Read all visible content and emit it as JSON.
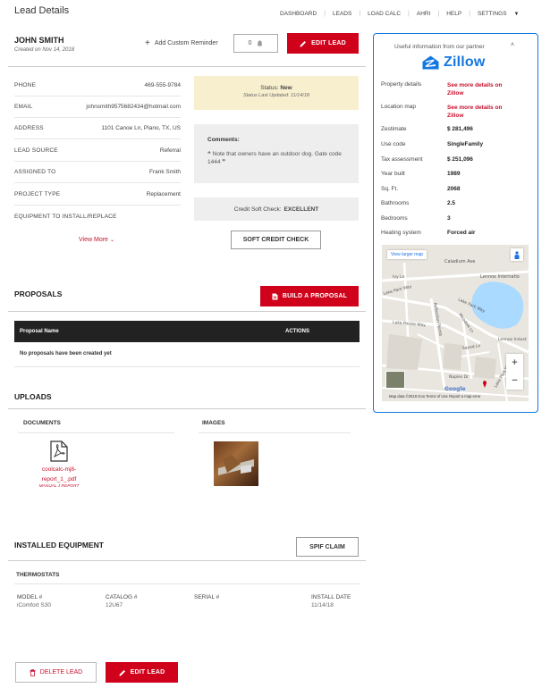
{
  "page": {
    "title": "Lead Details"
  },
  "nav": [
    "DASHBOARD",
    "LEADS",
    "LOAD CALC",
    "AHRI",
    "HELP",
    "SETTINGS"
  ],
  "lead": {
    "name": "JOHN SMITH",
    "created": "Created on Nov 14, 2018",
    "add_reminder": "Add Custom Reminder",
    "reminder_count": "0",
    "edit_label": "EDIT LEAD",
    "fields": [
      {
        "key": "PHONE",
        "value": "469-555-9784"
      },
      {
        "key": "EMAIL",
        "value": "johnsmith9575682434@hotmail.com"
      },
      {
        "key": "ADDRESS",
        "value": "1101 Canoe Ln, Plano, TX, US"
      },
      {
        "key": "LEAD SOURCE",
        "value": "Referral"
      },
      {
        "key": "ASSIGNED TO",
        "value": "Frank Smith"
      },
      {
        "key": "PROJECT TYPE",
        "value": "Replacement"
      },
      {
        "key": "EQUIPMENT TO INSTALL/REPLACE",
        "value": ""
      }
    ],
    "view_more": "View More",
    "status_label": "Status:",
    "status_value": "New",
    "status_updated": "Status Last Updated: 11/14/18",
    "comments_title": "Comments:",
    "comments_text": "Note that owners have an outdoor dog. Gate code 1444",
    "credit_label": "Credit Soft Check:",
    "credit_value": "EXCELLENT",
    "soft_credit_button": "SOFT CREDIT CHECK"
  },
  "zillow": {
    "partner_text": "Useful information from our partner",
    "brand": "Zillow",
    "rows": [
      {
        "key": "Property details",
        "value": "See more details on Zillow",
        "link": true
      },
      {
        "key": "Location map",
        "value": "See more details on Zillow",
        "link": true
      },
      {
        "key": "Zestimate",
        "value": "$ 281,496"
      },
      {
        "key": "Use code",
        "value": "SingleFamily"
      },
      {
        "key": "Tax assessment",
        "value": "$ 251,096"
      },
      {
        "key": "Year built",
        "value": "1989"
      },
      {
        "key": "Sq. Ft.",
        "value": "2068"
      },
      {
        "key": "Bathrooms",
        "value": "2.5"
      },
      {
        "key": "Bedrooms",
        "value": "3"
      },
      {
        "key": "Heating system",
        "value": "Forced air"
      }
    ],
    "map": {
      "view_larger": "View larger map",
      "streets": [
        "Caladium Ave",
        "Lennox Internatio",
        "Lake Park Way",
        "Lake Pointe Way",
        "Meadow Ln",
        "Lennox Indust",
        "Reflection Pointe",
        "Naples Dr",
        "Sayed Ln",
        "Ivy Ln",
        "Lake Park Way",
        "Lake Park Way"
      ],
      "google": "Google",
      "footer": "Map data ©2018 Goo  Terms of Use   Report a map error",
      "zoom_in": "+",
      "zoom_out": "−"
    }
  },
  "proposals": {
    "title": "PROPOSALS",
    "build_button": "BUILD A PROPOSAL",
    "col_name": "Proposal Name",
    "col_actions": "ACTIONS",
    "empty": "No proposals have been created yet"
  },
  "uploads": {
    "title": "UPLOADS",
    "documents_label": "DOCUMENTS",
    "images_label": "IMAGES",
    "doc_name_1": "coolcalc-mj8-",
    "doc_name_2": "report_1_.pdf",
    "doc_tag": "MANUAL J REPORT"
  },
  "installed": {
    "title": "INSTALLED EQUIPMENT",
    "spif_button": "SPIF CLAIM",
    "group": "THERMOSTATS",
    "columns": [
      "MODEL #",
      "CATALOG #",
      "SERIAL #",
      "INSTALL DATE"
    ],
    "values": [
      "iComfort S30",
      "12U67",
      "",
      "11/14/18"
    ]
  },
  "footer": {
    "delete_button": "DELETE LEAD",
    "edit_button": "EDIT LEAD"
  },
  "colors": {
    "accent": "#d0021b",
    "zillow_blue": "#1277e1",
    "status_bg": "#f8efcf",
    "grey_box": "#eeeeee"
  }
}
